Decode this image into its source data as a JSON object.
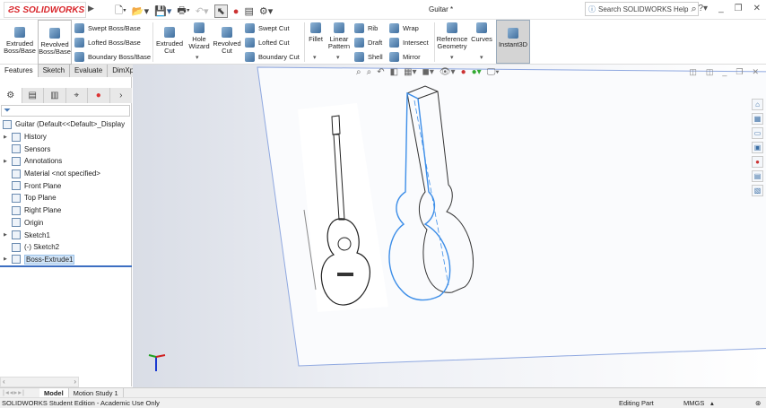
{
  "app": {
    "logo": "SOLIDWORKS",
    "document_title": "Guitar *",
    "search_placeholder": "Search SOLIDWORKS Help"
  },
  "ribbon": {
    "big": [
      {
        "label": "Extruded Boss/Base"
      },
      {
        "label": "Revolved Boss/Base"
      },
      {
        "label": "Extruded Cut"
      },
      {
        "label": "Hole Wizard"
      },
      {
        "label": "Revolved Cut"
      },
      {
        "label": "Fillet"
      },
      {
        "label": "Linear Pattern"
      },
      {
        "label": "Reference Geometry"
      },
      {
        "label": "Curves"
      },
      {
        "label": "Instant3D"
      }
    ],
    "small": [
      {
        "label": "Swept Boss/Base"
      },
      {
        "label": "Lofted Boss/Base"
      },
      {
        "label": "Boundary Boss/Base"
      },
      {
        "label": "Swept Cut"
      },
      {
        "label": "Lofted Cut"
      },
      {
        "label": "Boundary Cut"
      },
      {
        "label": "Rib"
      },
      {
        "label": "Draft"
      },
      {
        "label": "Shell"
      },
      {
        "label": "Wrap"
      },
      {
        "label": "Intersect"
      },
      {
        "label": "Mirror"
      }
    ]
  },
  "tabs": [
    {
      "label": "Features",
      "active": true
    },
    {
      "label": "Sketch"
    },
    {
      "label": "Evaluate"
    },
    {
      "label": "DimXpert"
    }
  ],
  "tree": {
    "root": "Guitar  (Default<<Default>_Display",
    "items": [
      {
        "label": "History",
        "expandable": true
      },
      {
        "label": "Sensors"
      },
      {
        "label": "Annotations",
        "expandable": true
      },
      {
        "label": "Material <not specified>"
      },
      {
        "label": "Front Plane"
      },
      {
        "label": "Top Plane"
      },
      {
        "label": "Right Plane"
      },
      {
        "label": "Origin"
      },
      {
        "label": "Sketch1",
        "expandable": true
      },
      {
        "label": "(-) Sketch2"
      },
      {
        "label": "Boss-Extrude1",
        "expandable": true,
        "selected": true
      }
    ]
  },
  "bottom_tabs": [
    {
      "label": "Model",
      "active": true
    },
    {
      "label": "Motion Study 1"
    }
  ],
  "status": {
    "left": "SOLIDWORKS Student Edition - Academic Use Only",
    "mode": "Editing Part",
    "units": "MMGS"
  },
  "colors": {
    "brand": "#d9262b",
    "selection": "#3d8ee8",
    "plane": "#8fa8e0"
  }
}
